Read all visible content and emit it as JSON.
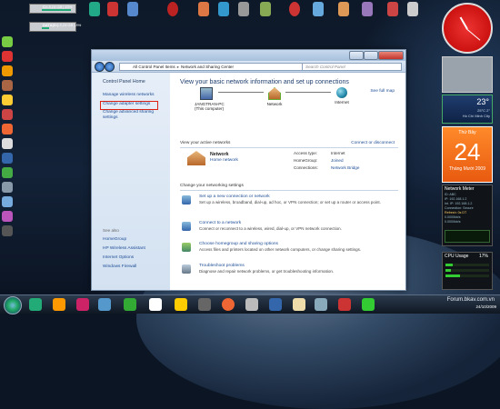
{
  "desktop": {
    "drives": [
      {
        "label": "C:\\",
        "info": "8,14 GB | 43%"
      },
      {
        "label": "DATA(D:)",
        "info": "5,24 GB | 8%"
      }
    ],
    "weather": {
      "temp": "23°",
      "range": "25°C 2°",
      "city": "Hồ Chí Minh City"
    },
    "calendar": {
      "weekday": "Thứ Bảy",
      "day": "24",
      "month": "Tháng Mười 2009"
    },
    "network_meter": {
      "title": "Network Meter",
      "rows": [
        "ID: ABC",
        "IP: 192.168.1.2",
        "Int. IP: 192.168.1.2",
        "Connection: Secure",
        "Refresh: 0s DT",
        "0.0000kb/s",
        "0.0000kb/s"
      ]
    },
    "cpu": {
      "title": "CPU Usage",
      "percent": "17%",
      "cores": [
        0.17,
        0.12,
        0.33
      ]
    },
    "forum": "Forum.bkav.com.vn",
    "tray": {
      "time": "24/10/2009"
    }
  },
  "window": {
    "breadcrumb": [
      "All Control Panel Items",
      "Network and Sharing Center"
    ],
    "search_placeholder": "Search Control Panel",
    "sidebar": {
      "title": "Control Panel Home",
      "links": [
        "Manage wireless networks",
        "Change adapter settings",
        "Change advanced sharing settings"
      ],
      "see_also_title": "See also",
      "see_also": [
        "HomeGroup",
        "HP Wireless Assistant",
        "Internet Options",
        "Windows Firewall"
      ]
    },
    "main": {
      "headline": "View your basic network information and set up connections",
      "see_full_map": "See full map",
      "nodes": [
        {
          "label": "JANGTRAN-PC",
          "sub": "(This computer)"
        },
        {
          "label": "Network",
          "sub": ""
        },
        {
          "label": "Internet",
          "sub": ""
        }
      ],
      "active_label": "View your active networks",
      "connect_link": "Connect or disconnect",
      "active": {
        "name": "Network",
        "type": "Home network",
        "access_type_key": "Access type:",
        "access_type": "Internet",
        "homegroup_key": "HomeGroup:",
        "homegroup": "Joined",
        "connections_key": "Connections:",
        "connections": "Network Bridge"
      },
      "change_label": "Change your networking settings",
      "tasks": [
        {
          "title": "Set up a new connection or network",
          "desc": "Set up a wireless, broadband, dial-up, ad hoc, or VPN connection; or set up a router or access point."
        },
        {
          "title": "Connect to a network",
          "desc": "Connect or reconnect to a wireless, wired, dial-up, or VPN network connection."
        },
        {
          "title": "Choose homegroup and sharing options",
          "desc": "Access files and printers located on other network computers, or change sharing settings."
        },
        {
          "title": "Troubleshoot problems",
          "desc": "Diagnose and repair network problems, or get troubleshooting information."
        }
      ]
    }
  }
}
